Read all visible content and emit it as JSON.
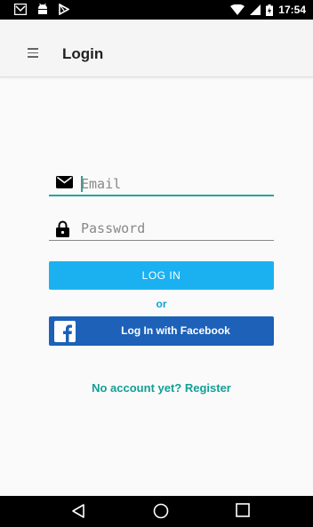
{
  "status_bar": {
    "time": "17:54",
    "icons": [
      "gmail-icon",
      "android-icon",
      "play-store-icon",
      "wifi-icon",
      "cell-signal-icon",
      "battery-charging-icon"
    ]
  },
  "app_bar": {
    "title": "Login",
    "menu_icon": "menu-icon"
  },
  "form": {
    "email": {
      "placeholder": "Email",
      "value": "",
      "icon": "email-icon"
    },
    "password": {
      "placeholder": "Password",
      "value": "",
      "icon": "lock-icon"
    },
    "login_label": "LOG IN",
    "or_label": "or",
    "facebook_label": "Log In with Facebook",
    "register_label": "No account yet? Register"
  },
  "nav_bar": {
    "icons": [
      "back-icon",
      "home-icon",
      "recents-icon"
    ]
  },
  "colors": {
    "accent": "#26a69a",
    "login_button": "#1bb1f0",
    "facebook_button": "#1d61b8",
    "or_text": "#0aa4dd",
    "register_text": "#129f96"
  }
}
